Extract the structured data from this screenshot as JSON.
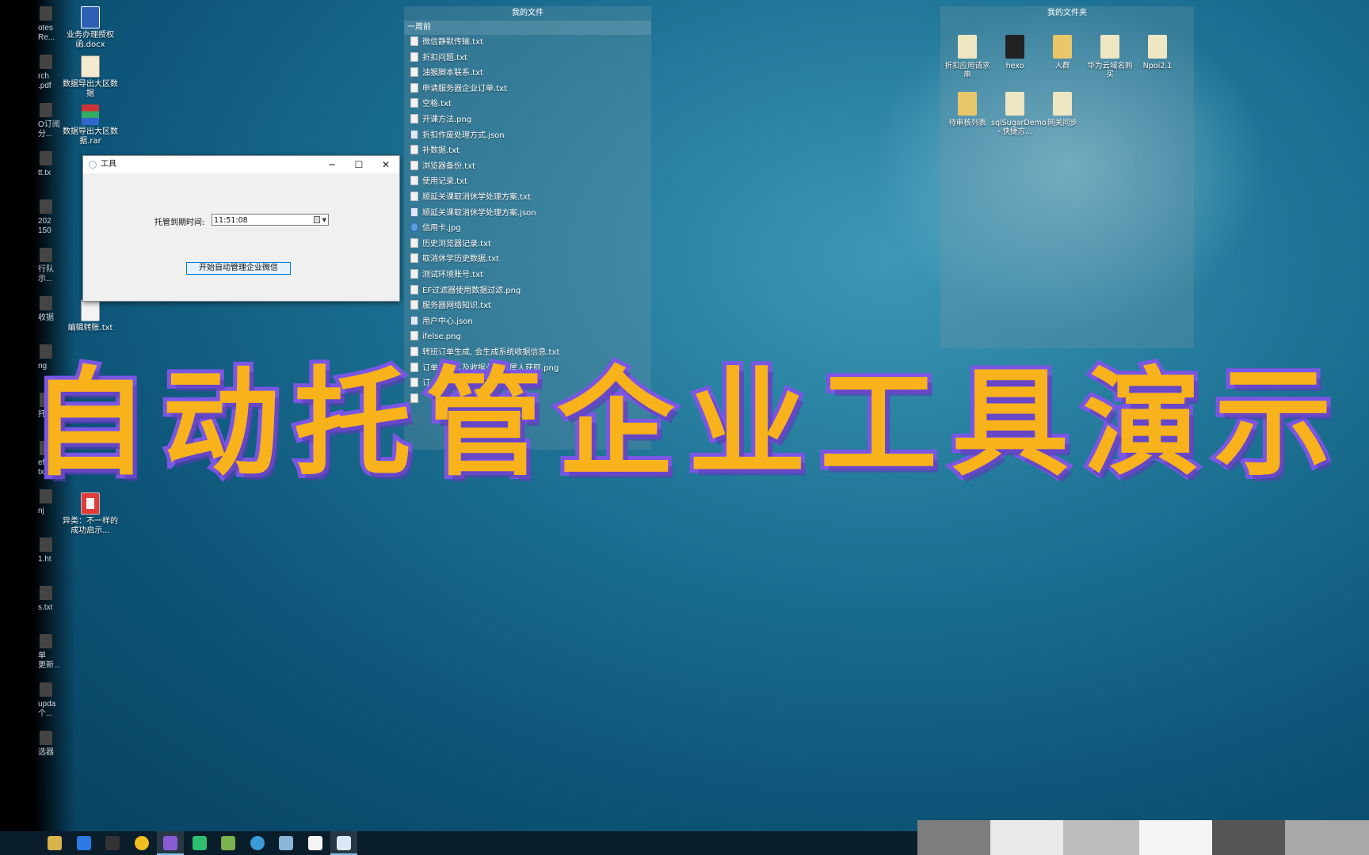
{
  "desktop_icons": [
    {
      "label": "业务办理授权函.docx",
      "type": "docx"
    },
    {
      "label": "数据导出大区数据",
      "type": "zip"
    },
    {
      "label": "数据导出大区数据.rar",
      "type": "rar"
    },
    {
      "label": "编辑转账.txt",
      "type": "txt"
    },
    {
      "label": "异类：不一样的成功启示...",
      "type": "pdf"
    }
  ],
  "partial_labels": [
    "otes\nRe...",
    "rch\n.pdf",
    "O订阅\n分...",
    "tt.tx",
    "202\n150",
    "行队\n示...",
    "收据",
    "ng",
    "托",
    "ef\ntxt",
    "nj",
    "1.ht",
    "s.txt",
    "单\n更新...",
    "upda\n个...",
    "选器"
  ],
  "fence_files": {
    "title": "我的文件",
    "group": "一周前",
    "items": [
      {
        "name": "微信静默传输.txt",
        "type": "txt"
      },
      {
        "name": "折扣问题.txt",
        "type": "txt"
      },
      {
        "name": "油猴脚本联系.txt",
        "type": "txt"
      },
      {
        "name": "申请服务器企业订单.txt",
        "type": "txt"
      },
      {
        "name": "空格.txt",
        "type": "txt"
      },
      {
        "name": "开课方法.png",
        "type": "png"
      },
      {
        "name": "折扣作废处理方式.json",
        "type": "json"
      },
      {
        "name": "补数据.txt",
        "type": "txt"
      },
      {
        "name": "浏览器备份.txt",
        "type": "txt"
      },
      {
        "name": "使用记录.txt",
        "type": "txt"
      },
      {
        "name": "顺延关课取消休学处理方案.txt",
        "type": "txt"
      },
      {
        "name": "顺延关课取消休学处理方案.json",
        "type": "json"
      },
      {
        "name": "信用卡.jpg",
        "type": "jpg"
      },
      {
        "name": "历史浏览器记录.txt",
        "type": "txt"
      },
      {
        "name": "取消休学历史数据.txt",
        "type": "txt"
      },
      {
        "name": "测试环境账号.txt",
        "type": "txt"
      },
      {
        "name": "EF过滤器使用数据过滤.png",
        "type": "png"
      },
      {
        "name": "服务器网络知识.txt",
        "type": "txt"
      },
      {
        "name": "用户中心.json",
        "type": "json"
      },
      {
        "name": "ifelse.png",
        "type": "png"
      },
      {
        "name": "转班订单生成, 会生成系统收据信息.txt",
        "type": "txt"
      },
      {
        "name": "订单所属人及收据业绩归属人获取.png",
        "type": "png"
      },
      {
        "name": "订",
        "type": "txt"
      },
      {
        "name": "",
        "type": "txt"
      }
    ]
  },
  "fence_folders": {
    "title": "我的文件夹",
    "items": [
      {
        "label": "折扣应用请求串",
        "kind": "doc"
      },
      {
        "label": "hexo",
        "kind": "dark"
      },
      {
        "label": "人群",
        "kind": "folder"
      },
      {
        "label": "华为云域名购买",
        "kind": "doc"
      },
      {
        "label": "Npoi2.1",
        "kind": "doc"
      },
      {
        "label": "待审核列表",
        "kind": "folder"
      },
      {
        "label": "sqlSugarDemo - 快捷方...",
        "kind": "shortcut"
      },
      {
        "label": "网关同步",
        "kind": "shortcut"
      }
    ]
  },
  "window": {
    "title": "工具",
    "minimize": "─",
    "maximize": "☐",
    "close": "✕",
    "expire_label": "托管到期时间:",
    "expire_value": "11:51:08",
    "start_button": "开始自动管理企业微信"
  },
  "banner": {
    "text": "自动托管企业工具演示"
  },
  "taskbar": {
    "icons": [
      "git-icon",
      "todo-icon",
      "terminal-icon",
      "chrome-icon",
      "visual-studio-icon",
      "datagrip-icon",
      "notepad-plus-icon",
      "search-tool-icon",
      "pen-icon",
      "typora-icon",
      "tool-window-icon"
    ],
    "colors": [
      "#d8b34a",
      "#2c7be5",
      "#333333",
      "#f0c020",
      "#8a5bd6",
      "#2dbf6e",
      "#7ab34d",
      "#3a9bd8",
      "#8ab4d8",
      "#f4f4f4",
      "#dbe9f7"
    ]
  },
  "accent_colors": {
    "banner_fill": "#f7b21c",
    "banner_stroke": "#7b56e4",
    "button_border": "#0078d7"
  }
}
